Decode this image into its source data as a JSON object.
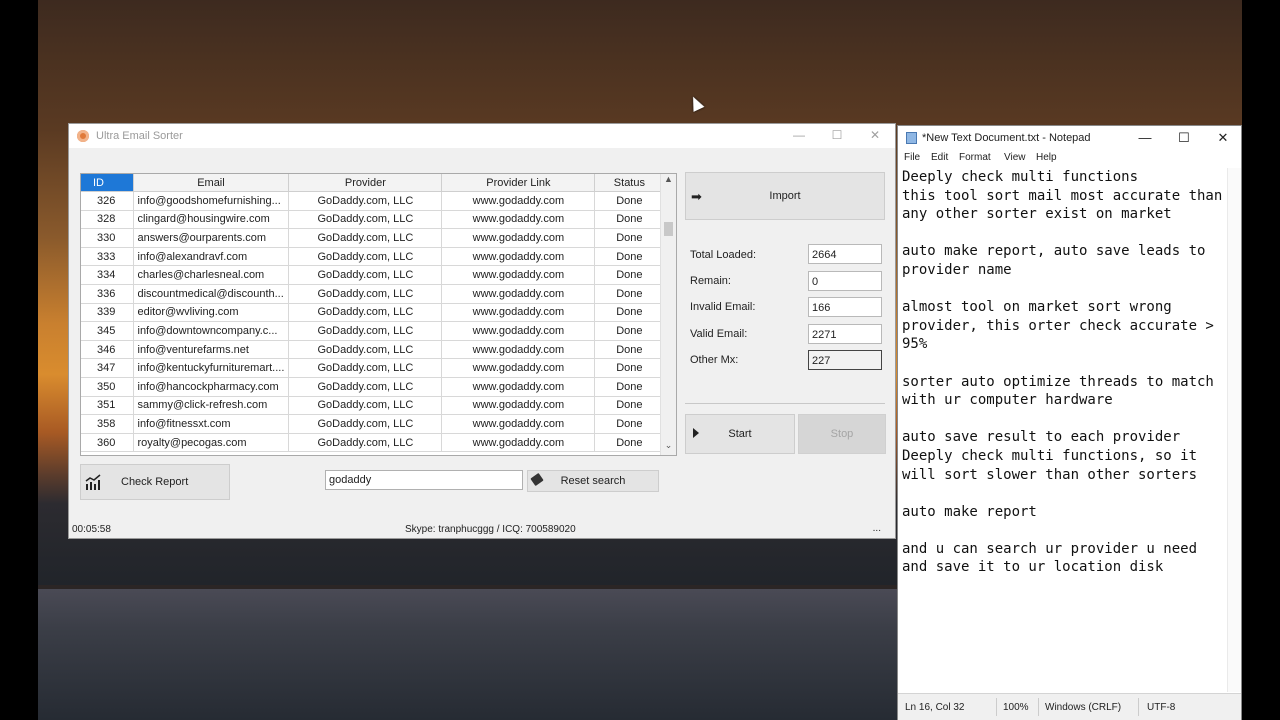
{
  "app": {
    "title": "Ultra Email Sorter",
    "columns": [
      "ID",
      "Email",
      "Provider",
      "Provider Link",
      "Status"
    ],
    "rows": [
      {
        "id": "326",
        "email": "info@goodshomefurnishing...",
        "provider": "GoDaddy.com, LLC",
        "link": "www.godaddy.com",
        "status": "Done"
      },
      {
        "id": "328",
        "email": "clingard@housingwire.com",
        "provider": "GoDaddy.com, LLC",
        "link": "www.godaddy.com",
        "status": "Done"
      },
      {
        "id": "330",
        "email": "answers@ourparents.com",
        "provider": "GoDaddy.com, LLC",
        "link": "www.godaddy.com",
        "status": "Done"
      },
      {
        "id": "333",
        "email": "info@alexandravf.com",
        "provider": "GoDaddy.com, LLC",
        "link": "www.godaddy.com",
        "status": "Done"
      },
      {
        "id": "334",
        "email": "charles@charlesneal.com",
        "provider": "GoDaddy.com, LLC",
        "link": "www.godaddy.com",
        "status": "Done"
      },
      {
        "id": "336",
        "email": "discountmedical@discounth...",
        "provider": "GoDaddy.com, LLC",
        "link": "www.godaddy.com",
        "status": "Done"
      },
      {
        "id": "339",
        "email": "editor@wvliving.com",
        "provider": "GoDaddy.com, LLC",
        "link": "www.godaddy.com",
        "status": "Done"
      },
      {
        "id": "345",
        "email": "info@downtowncompany.c...",
        "provider": "GoDaddy.com, LLC",
        "link": "www.godaddy.com",
        "status": "Done"
      },
      {
        "id": "346",
        "email": "info@venturefarms.net",
        "provider": "GoDaddy.com, LLC",
        "link": "www.godaddy.com",
        "status": "Done"
      },
      {
        "id": "347",
        "email": "info@kentuckyfurnituremart....",
        "provider": "GoDaddy.com, LLC",
        "link": "www.godaddy.com",
        "status": "Done"
      },
      {
        "id": "350",
        "email": "info@hancockpharmacy.com",
        "provider": "GoDaddy.com, LLC",
        "link": "www.godaddy.com",
        "status": "Done"
      },
      {
        "id": "351",
        "email": "sammy@click-refresh.com",
        "provider": "GoDaddy.com, LLC",
        "link": "www.godaddy.com",
        "status": "Done"
      },
      {
        "id": "358",
        "email": "info@fitnessxt.com",
        "provider": "GoDaddy.com, LLC",
        "link": "www.godaddy.com",
        "status": "Done"
      },
      {
        "id": "360",
        "email": "royalty@pecogas.com",
        "provider": "GoDaddy.com, LLC",
        "link": "www.godaddy.com",
        "status": "Done"
      }
    ],
    "import_label": "Import",
    "stats": {
      "total_loaded_label": "Total Loaded:",
      "total_loaded": "2664",
      "remain_label": "Remain:",
      "remain": "0",
      "invalid_label": "Invalid Email:",
      "invalid": "166",
      "valid_label": "Valid Email:",
      "valid": "2271",
      "other_label": "Other Mx:",
      "other": "227"
    },
    "start_label": "Start",
    "stop_label": "Stop",
    "check_report_label": "Check Report",
    "search_value": "godaddy",
    "reset_label": "Reset search",
    "status_time": "00:05:58",
    "status_contact": "Skype: tranphucggg / ICQ: 700589020",
    "status_dots": "..."
  },
  "notepad": {
    "title": "*New Text Document.txt - Notepad",
    "menu": [
      "File",
      "Edit",
      "Format",
      "View",
      "Help"
    ],
    "content": "Deeply check multi functions\nthis tool sort mail most accurate than\nany other sorter exist on market\n\nauto make report, auto save leads to\nprovider name\n\nalmost tool on market sort wrong\nprovider, this orter check accurate >\n95%\n\nsorter auto optimize threads to match\nwith ur computer hardware\n\nauto save result to each provider\nDeeply check multi functions, so it\nwill sort slower than other sorters\n\nauto make report\n\nand u can search ur provider u need\nand save it to ur location disk",
    "status_pos": "Ln 16, Col 32",
    "status_zoom": "100%",
    "status_eol": "Windows (CRLF)",
    "status_enc": "UTF-8"
  }
}
